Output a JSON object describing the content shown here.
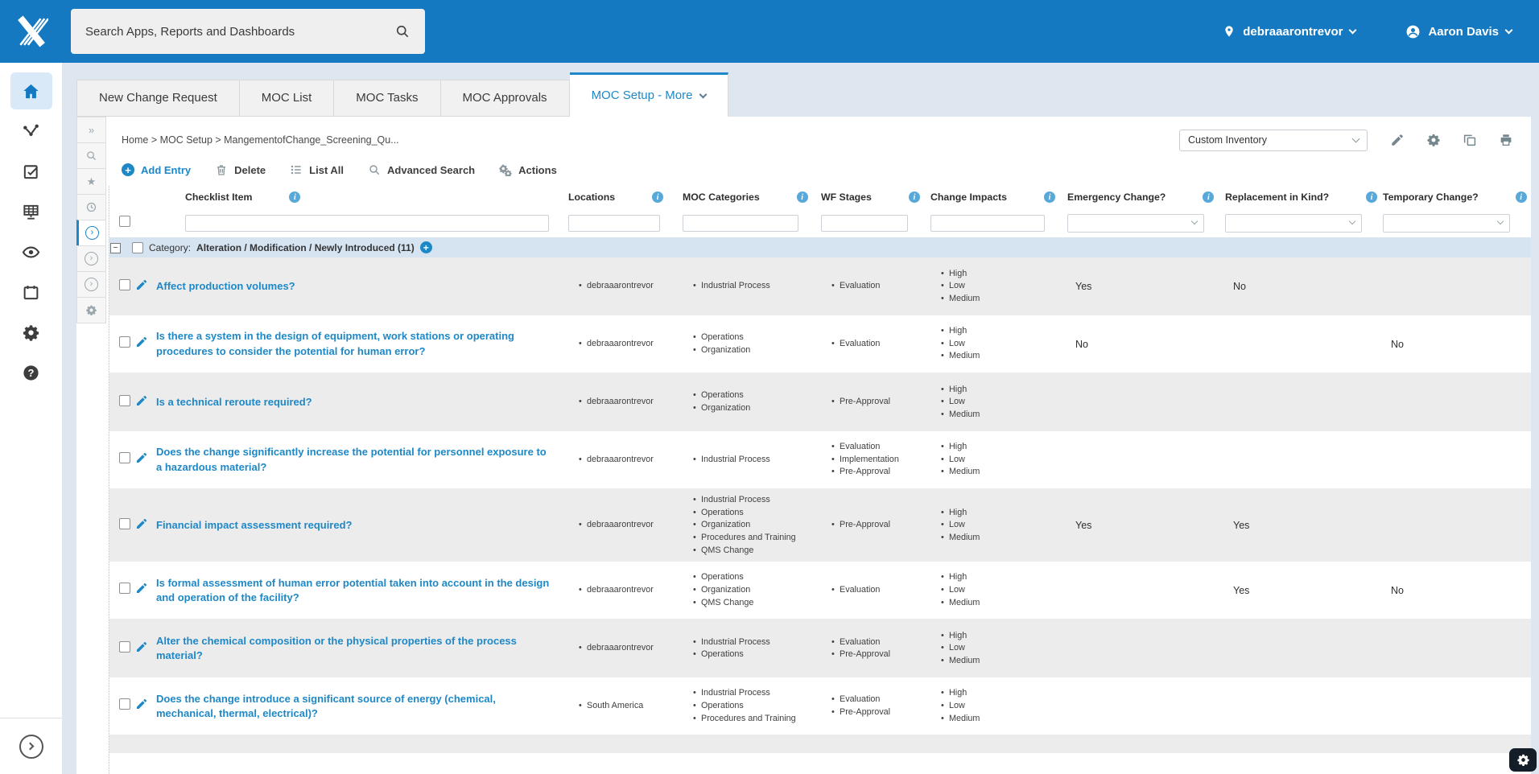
{
  "topbar": {
    "search_placeholder": "Search Apps, Reports and Dashboards",
    "location": "debraaarontrevor",
    "user_name": "Aaron Davis"
  },
  "tabs": [
    {
      "label": "New Change Request"
    },
    {
      "label": "MOC List"
    },
    {
      "label": "MOC Tasks"
    },
    {
      "label": "MOC Approvals"
    },
    {
      "label": "MOC Setup - More",
      "active": true
    }
  ],
  "page": {
    "breadcrumb": "Home > MOC Setup > MangementofChange_Screening_Qu...",
    "view_selector": "Custom Inventory"
  },
  "toolbar": {
    "add_entry": "Add Entry",
    "delete": "Delete",
    "list_all": "List All",
    "advanced_search": "Advanced Search",
    "actions": "Actions"
  },
  "table": {
    "columns": [
      "Checklist Item",
      "Locations",
      "MOC Categories",
      "WF Stages",
      "Change Impacts",
      "Emergency Change?",
      "Replacement in Kind?",
      "Temporary Change?"
    ],
    "category": {
      "prefix": "Category:",
      "name_with_count": "Alteration / Modification / Newly Introduced (11)"
    },
    "rows": [
      {
        "item": "Affect production volumes?",
        "locations": [
          "debraaarontrevor"
        ],
        "categories": [
          "Industrial Process"
        ],
        "stages": [
          "Evaluation"
        ],
        "impacts": [
          "High",
          "Low",
          "Medium"
        ],
        "emergency": "Yes",
        "replacement": "No",
        "temporary": ""
      },
      {
        "item": "Is there a system in the design of equipment, work stations or operating procedures to consider the potential for human error?",
        "locations": [
          "debraaarontrevor"
        ],
        "categories": [
          "Operations",
          "Organization"
        ],
        "stages": [
          "Evaluation"
        ],
        "impacts": [
          "High",
          "Low",
          "Medium"
        ],
        "emergency": "No",
        "replacement": "",
        "temporary": "No"
      },
      {
        "item": "Is a technical reroute required?",
        "locations": [
          "debraaarontrevor"
        ],
        "categories": [
          "Operations",
          "Organization"
        ],
        "stages": [
          "Pre-Approval"
        ],
        "impacts": [
          "High",
          "Low",
          "Medium"
        ],
        "emergency": "",
        "replacement": "",
        "temporary": ""
      },
      {
        "item": "Does the change significantly increase the potential for personnel exposure to a hazardous material?",
        "locations": [
          "debraaarontrevor"
        ],
        "categories": [
          "Industrial Process"
        ],
        "stages": [
          "Evaluation",
          "Implementation",
          "Pre-Approval"
        ],
        "impacts": [
          "High",
          "Low",
          "Medium"
        ],
        "emergency": "",
        "replacement": "",
        "temporary": ""
      },
      {
        "item": "Financial impact assessment required?",
        "locations": [
          "debraaarontrevor"
        ],
        "categories": [
          "Industrial Process",
          "Operations",
          "Organization",
          "Procedures and Training",
          "QMS Change"
        ],
        "stages": [
          "Pre-Approval"
        ],
        "impacts": [
          "High",
          "Low",
          "Medium"
        ],
        "emergency": "Yes",
        "replacement": "Yes",
        "temporary": ""
      },
      {
        "item": "Is formal assessment of human error potential taken into account in the design and operation of the facility?",
        "locations": [
          "debraaarontrevor"
        ],
        "categories": [
          "Operations",
          "Organization",
          "QMS Change"
        ],
        "stages": [
          "Evaluation"
        ],
        "impacts": [
          "High",
          "Low",
          "Medium"
        ],
        "emergency": "",
        "replacement": "Yes",
        "temporary": "No"
      },
      {
        "item": "Alter the chemical composition or the physical properties of the process material?",
        "locations": [
          "debraaarontrevor"
        ],
        "categories": [
          "Industrial Process",
          "Operations"
        ],
        "stages": [
          "Evaluation",
          "Pre-Approval"
        ],
        "impacts": [
          "High",
          "Low",
          "Medium"
        ],
        "emergency": "",
        "replacement": "",
        "temporary": ""
      },
      {
        "item": "Does the change introduce a significant source of energy (chemical, mechanical, thermal, electrical)?",
        "locations": [
          "South America"
        ],
        "categories": [
          "Industrial Process",
          "Operations",
          "Procedures and Training"
        ],
        "stages": [
          "Evaluation",
          "Pre-Approval"
        ],
        "impacts": [
          "High",
          "Low",
          "Medium"
        ],
        "emergency": "",
        "replacement": "",
        "temporary": ""
      }
    ]
  }
}
